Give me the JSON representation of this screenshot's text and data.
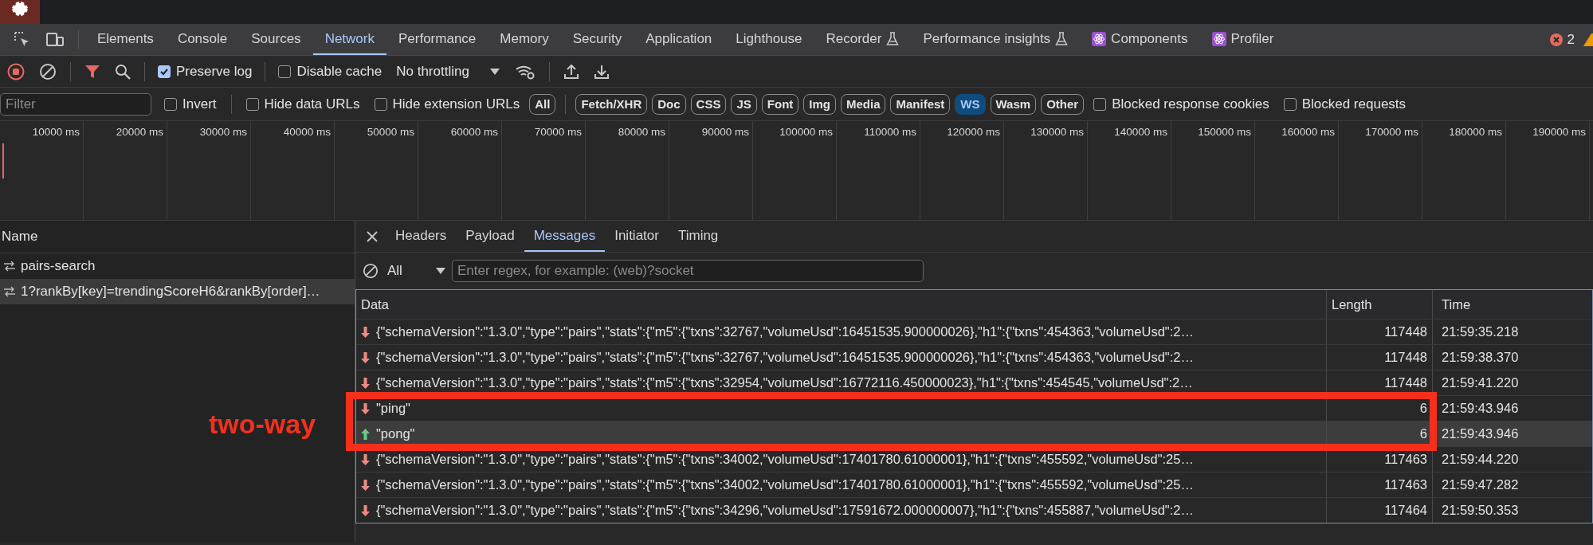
{
  "devtools_tabs": [
    {
      "label": "Elements",
      "kind": "plain",
      "selected": false
    },
    {
      "label": "Console",
      "kind": "plain",
      "selected": false
    },
    {
      "label": "Sources",
      "kind": "plain",
      "selected": false
    },
    {
      "label": "Network",
      "kind": "plain",
      "selected": true
    },
    {
      "label": "Performance",
      "kind": "plain",
      "selected": false
    },
    {
      "label": "Memory",
      "kind": "plain",
      "selected": false
    },
    {
      "label": "Security",
      "kind": "plain",
      "selected": false
    },
    {
      "label": "Application",
      "kind": "plain",
      "selected": false
    },
    {
      "label": "Lighthouse",
      "kind": "plain",
      "selected": false
    },
    {
      "label": "Recorder",
      "kind": "experimental",
      "selected": false
    },
    {
      "label": "Performance insights",
      "kind": "experimental",
      "selected": false
    },
    {
      "label": "Components",
      "kind": "react",
      "selected": false
    },
    {
      "label": "Profiler",
      "kind": "react",
      "selected": false
    }
  ],
  "error_count": "2",
  "toolbar": {
    "preserve_log": {
      "label": "Preserve log",
      "checked": true
    },
    "disable_cache": {
      "label": "Disable cache",
      "checked": false
    },
    "throttling": "No throttling"
  },
  "filter_bar": {
    "placeholder": "Filter",
    "checkboxes": [
      {
        "label": "Invert",
        "checked": false
      },
      {
        "label": "Hide data URLs",
        "checked": false
      },
      {
        "label": "Hide extension URLs",
        "checked": false
      }
    ],
    "type_buttons": [
      {
        "label": "All",
        "selected": false
      },
      {
        "label": "Fetch/XHR",
        "selected": false
      },
      {
        "label": "Doc",
        "selected": false
      },
      {
        "label": "CSS",
        "selected": false
      },
      {
        "label": "JS",
        "selected": false
      },
      {
        "label": "Font",
        "selected": false
      },
      {
        "label": "Img",
        "selected": false
      },
      {
        "label": "Media",
        "selected": false
      },
      {
        "label": "Manifest",
        "selected": false
      },
      {
        "label": "WS",
        "selected": true
      },
      {
        "label": "Wasm",
        "selected": false
      },
      {
        "label": "Other",
        "selected": false
      }
    ],
    "more_checkboxes": [
      {
        "label": "Blocked response cookies",
        "checked": false
      },
      {
        "label": "Blocked requests",
        "checked": false
      }
    ]
  },
  "timeline_ticks": [
    "10000 ms",
    "20000 ms",
    "30000 ms",
    "40000 ms",
    "50000 ms",
    "60000 ms",
    "70000 ms",
    "80000 ms",
    "90000 ms",
    "100000 ms",
    "110000 ms",
    "120000 ms",
    "130000 ms",
    "140000 ms",
    "150000 ms",
    "160000 ms",
    "170000 ms",
    "180000 ms",
    "190000 ms"
  ],
  "requests": {
    "header": "Name",
    "items": [
      {
        "name": "pairs-search",
        "selected": false
      },
      {
        "name": "1?rankBy[key]=trendingScoreH6&rankBy[order]…",
        "selected": true
      }
    ]
  },
  "detail_tabs": [
    {
      "label": "Headers",
      "selected": false
    },
    {
      "label": "Payload",
      "selected": false
    },
    {
      "label": "Messages",
      "selected": true
    },
    {
      "label": "Initiator",
      "selected": false
    },
    {
      "label": "Timing",
      "selected": false
    }
  ],
  "message_filter": {
    "type": "All",
    "placeholder": "Enter regex, for example: (web)?socket"
  },
  "messages": {
    "columns": [
      "Data",
      "Length",
      "Time"
    ],
    "rows": [
      {
        "sent": false,
        "selected": false,
        "data": "{\"schemaVersion\":\"1.3.0\",\"type\":\"pairs\",\"stats\":{\"m5\":{\"txns\":32767,\"volumeUsd\":16451535.900000026},\"h1\":{\"txns\":454363,\"volumeUsd\":2…",
        "length": "117448",
        "time": "21:59:35.218"
      },
      {
        "sent": false,
        "selected": false,
        "data": "{\"schemaVersion\":\"1.3.0\",\"type\":\"pairs\",\"stats\":{\"m5\":{\"txns\":32767,\"volumeUsd\":16451535.900000026},\"h1\":{\"txns\":454363,\"volumeUsd\":2…",
        "length": "117448",
        "time": "21:59:38.370"
      },
      {
        "sent": false,
        "selected": false,
        "data": "{\"schemaVersion\":\"1.3.0\",\"type\":\"pairs\",\"stats\":{\"m5\":{\"txns\":32954,\"volumeUsd\":16772116.450000023},\"h1\":{\"txns\":454545,\"volumeUsd\":2…",
        "length": "117448",
        "time": "21:59:41.220"
      },
      {
        "sent": false,
        "selected": false,
        "data": "\"ping\"",
        "length": "6",
        "time": "21:59:43.946"
      },
      {
        "sent": true,
        "selected": true,
        "data": "\"pong\"",
        "length": "6",
        "time": "21:59:43.946"
      },
      {
        "sent": false,
        "selected": false,
        "data": "{\"schemaVersion\":\"1.3.0\",\"type\":\"pairs\",\"stats\":{\"m5\":{\"txns\":34002,\"volumeUsd\":17401780.61000001},\"h1\":{\"txns\":455592,\"volumeUsd\":25…",
        "length": "117463",
        "time": "21:59:44.220"
      },
      {
        "sent": false,
        "selected": false,
        "data": "{\"schemaVersion\":\"1.3.0\",\"type\":\"pairs\",\"stats\":{\"m5\":{\"txns\":34002,\"volumeUsd\":17401780.61000001},\"h1\":{\"txns\":455592,\"volumeUsd\":25…",
        "length": "117463",
        "time": "21:59:47.282"
      },
      {
        "sent": false,
        "selected": false,
        "data": "{\"schemaVersion\":\"1.3.0\",\"type\":\"pairs\",\"stats\":{\"m5\":{\"txns\":34296,\"volumeUsd\":17591672.000000007},\"h1\":{\"txns\":455887,\"volumeUsd\":2…",
        "length": "117464",
        "time": "21:59:50.353"
      }
    ]
  },
  "annotation": {
    "label": "two-way"
  }
}
